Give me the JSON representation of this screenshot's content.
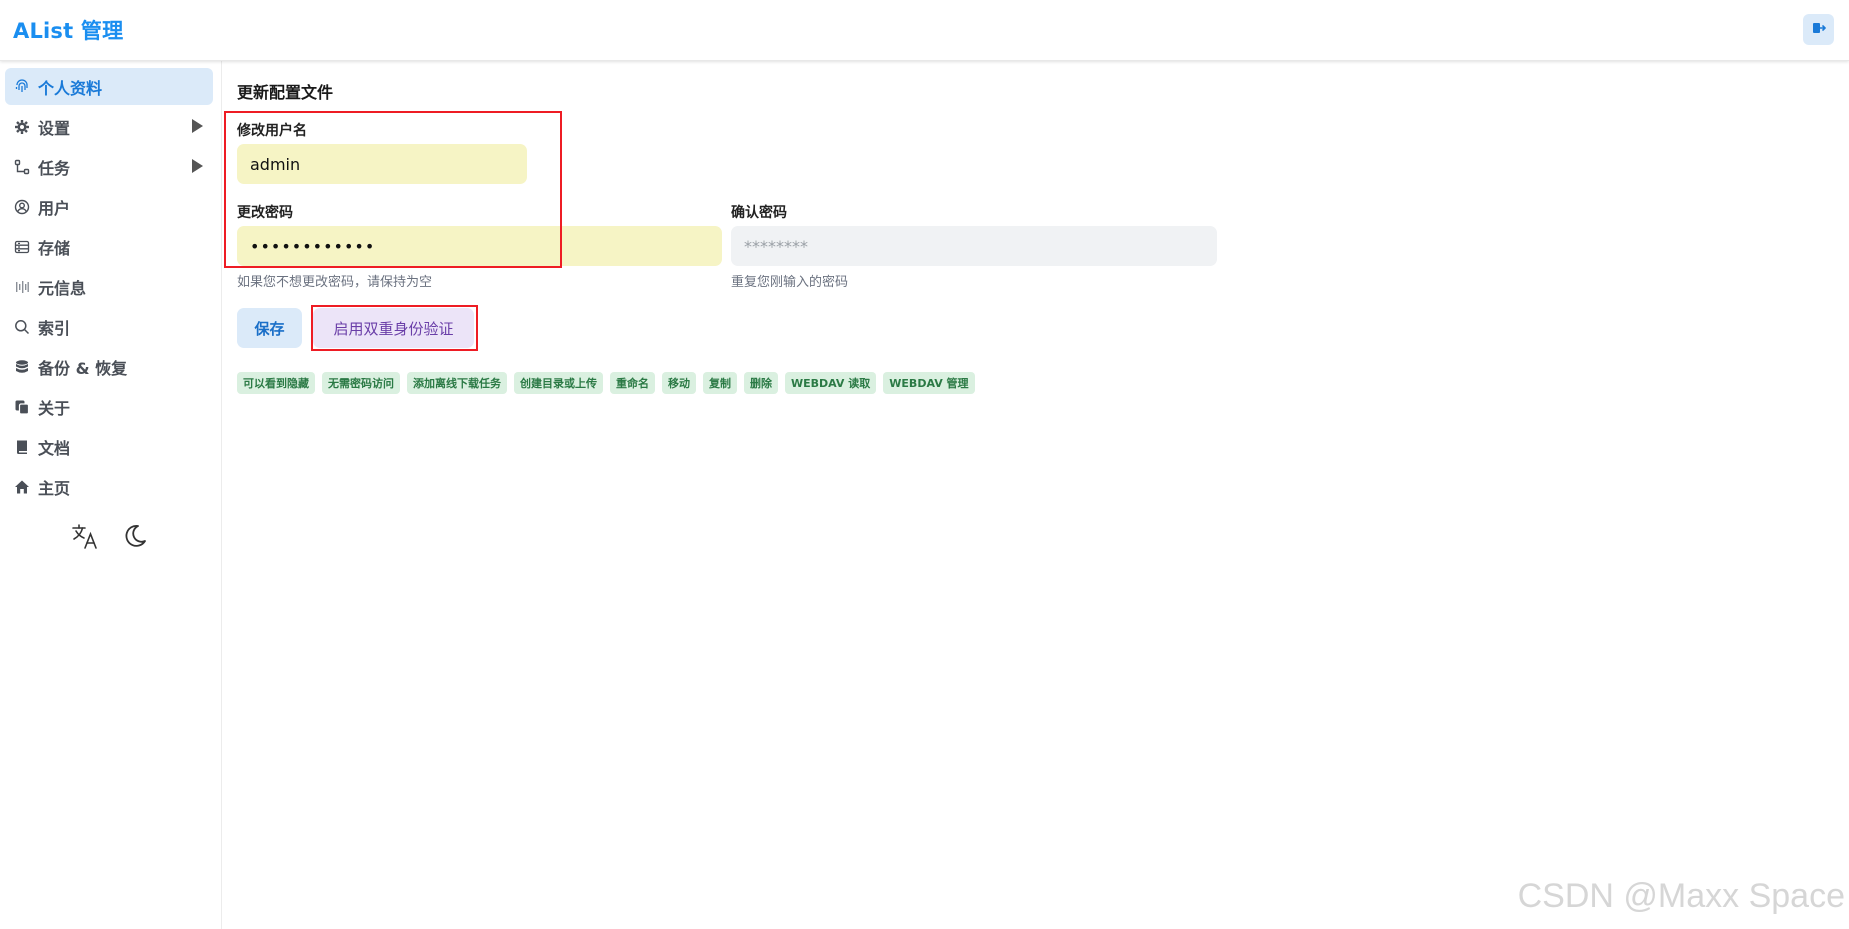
{
  "header": {
    "title": "AList 管理",
    "logout_icon": "logout-icon"
  },
  "sidebar": {
    "items": [
      {
        "label": "个人资料",
        "icon": "fingerprint-icon",
        "active": true
      },
      {
        "label": "设置",
        "icon": "gear-icon",
        "expandable": true
      },
      {
        "label": "任务",
        "icon": "flow-icon",
        "expandable": true
      },
      {
        "label": "用户",
        "icon": "user-circle-icon"
      },
      {
        "label": "存储",
        "icon": "storage-icon"
      },
      {
        "label": "元信息",
        "icon": "meta-icon"
      },
      {
        "label": "索引",
        "icon": "search-icon"
      },
      {
        "label": "备份 & 恢复",
        "icon": "database-icon"
      },
      {
        "label": "关于",
        "icon": "copy-icon"
      },
      {
        "label": "文档",
        "icon": "book-icon"
      },
      {
        "label": "主页",
        "icon": "home-icon"
      }
    ],
    "bottom_icons": [
      "translate-icon",
      "moon-icon"
    ]
  },
  "main": {
    "title": "更新配置文件",
    "username": {
      "label": "修改用户名",
      "value": "admin"
    },
    "password": {
      "label": "更改密码",
      "value": "••••••••••••",
      "hint": "如果您不想更改密码，请保持为空"
    },
    "confirm": {
      "label": "确认密码",
      "placeholder": "********",
      "hint": "重复您刚输入的密码"
    },
    "buttons": {
      "save": "保存",
      "two_factor": "启用双重身份验证"
    },
    "permissions": [
      "可以看到隐藏",
      "无需密码访问",
      "添加离线下载任务",
      "创建目录或上传",
      "重命名",
      "移动",
      "复制",
      "删除",
      "WEBDAV 读取",
      "WEBDAV 管理"
    ]
  },
  "watermark": "CSDN @Maxx Space",
  "colors": {
    "accent": "#1a8ef0",
    "autofill": "#f6f4c5",
    "tag_bg": "#daf0e0",
    "highlight": "#ee1c24"
  }
}
